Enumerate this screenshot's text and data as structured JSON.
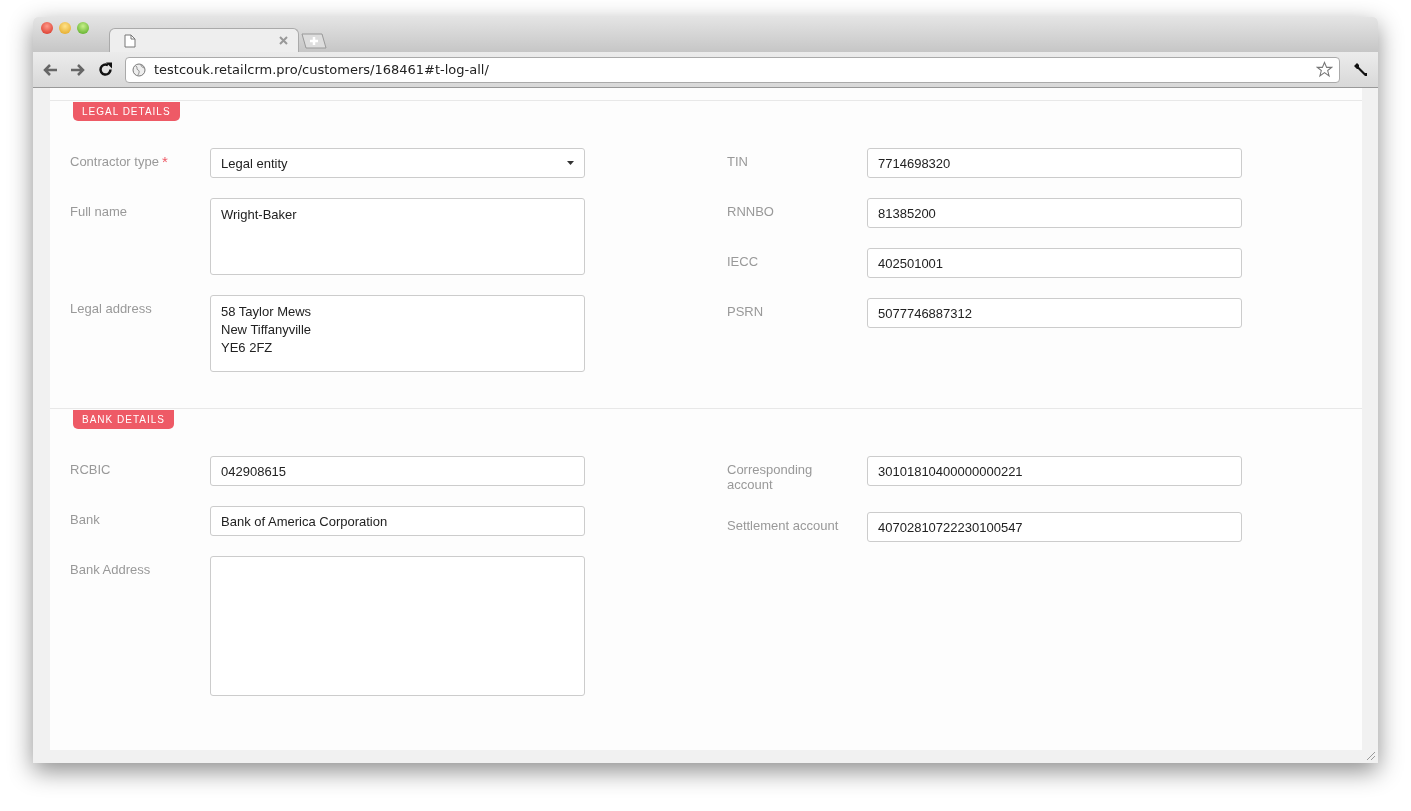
{
  "browser": {
    "url": "testcouk.retailcrm.pro/customers/168461#t-log-all/"
  },
  "sections": [
    {
      "title": "LEGAL DETAILS",
      "columns": [
        [
          {
            "label": "Contractor type",
            "required_mark": "*",
            "kind": "select",
            "value": "Legal entity"
          },
          {
            "label": "Full name",
            "kind": "textarea",
            "value": "Wright-Baker"
          },
          {
            "label": "Legal address",
            "kind": "textarea",
            "value": "58 Taylor Mews\nNew Tiffanyville\nYE6 2FZ"
          }
        ],
        [
          {
            "label": "TIN",
            "kind": "input",
            "value": "7714698320"
          },
          {
            "label": "RNNBO",
            "kind": "input",
            "value": "81385200"
          },
          {
            "label": "IECC",
            "kind": "input",
            "value": "402501001"
          },
          {
            "label": "PSRN",
            "kind": "input",
            "value": "5077746887312"
          }
        ]
      ]
    },
    {
      "title": "BANK DETAILS",
      "columns": [
        [
          {
            "label": "RCBIC",
            "kind": "input",
            "value": "042908615"
          },
          {
            "label": "Bank",
            "kind": "input",
            "value": "Bank of America Corporation"
          },
          {
            "label": "Bank Address",
            "kind": "large-textarea"
          }
        ],
        [
          {
            "label": "Corresponding account",
            "kind": "input",
            "value": "30101810400000000221"
          },
          {
            "label": "Settlement account",
            "kind": "input",
            "value": "40702810722230100547"
          }
        ]
      ]
    }
  ]
}
